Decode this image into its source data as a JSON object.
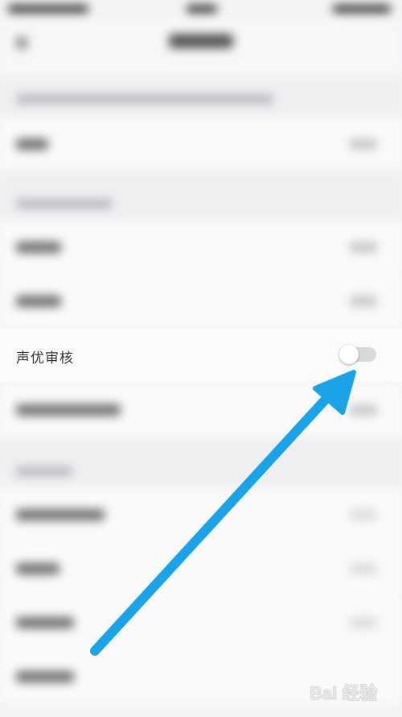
{
  "highlighted_setting": {
    "label": "声优审核",
    "enabled": false
  },
  "annotation": {
    "arrow_color": "#1aa3e8"
  },
  "watermark": {
    "text": "Bai 经验"
  }
}
